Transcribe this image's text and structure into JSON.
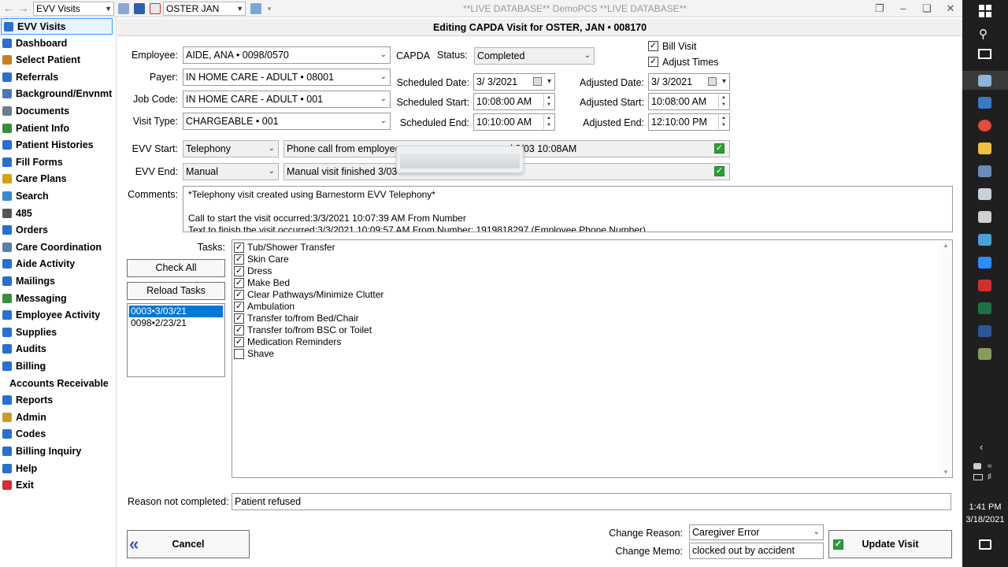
{
  "toolbar": {
    "module_select": "EVV Visits",
    "patient_select": "OSTER JAN",
    "window_title": "**LIVE DATABASE** DemoPCS **LIVE DATABASE**"
  },
  "sidebar": {
    "items": [
      {
        "label": "EVV Visits",
        "icon": "evv-icon",
        "active": true
      },
      {
        "label": "Dashboard",
        "icon": "dashboard-icon"
      },
      {
        "label": "Select Patient",
        "icon": "home-icon"
      },
      {
        "label": "Referrals",
        "icon": "referrals-icon"
      },
      {
        "label": "Background/Envnmt",
        "icon": "background-icon"
      },
      {
        "label": "Documents",
        "icon": "documents-icon"
      },
      {
        "label": "Patient Info",
        "icon": "patient-info-icon"
      },
      {
        "label": "Patient Histories",
        "icon": "histories-icon"
      },
      {
        "label": "Fill Forms",
        "icon": "forms-icon"
      },
      {
        "label": "Care Plans",
        "icon": "care-plans-icon"
      },
      {
        "label": "Search",
        "icon": "search-icon"
      },
      {
        "label": "485",
        "icon": "485-icon"
      },
      {
        "label": "Orders",
        "icon": "orders-icon"
      },
      {
        "label": "Care Coordination",
        "icon": "coordination-icon"
      },
      {
        "label": "Aide Activity",
        "icon": "aide-icon"
      },
      {
        "label": "Mailings",
        "icon": "mailings-icon"
      },
      {
        "label": "Messaging",
        "icon": "messaging-icon"
      },
      {
        "label": "Employee Activity",
        "icon": "employee-icon"
      },
      {
        "label": "Supplies",
        "icon": "supplies-icon"
      },
      {
        "label": "Audits",
        "icon": "audits-icon"
      },
      {
        "label": "Billing",
        "icon": "billing-icon"
      },
      {
        "label": "Accounts Receivable",
        "icon": "ar-icon"
      },
      {
        "label": "Reports",
        "icon": "reports-icon"
      },
      {
        "label": "Admin",
        "icon": "lock-icon"
      },
      {
        "label": "Codes",
        "icon": "codes-icon"
      },
      {
        "label": "Billing Inquiry",
        "icon": "inquiry-icon"
      },
      {
        "label": "Help",
        "icon": "help-icon"
      },
      {
        "label": "Exit",
        "icon": "exit-icon"
      }
    ]
  },
  "heading": "Editing CAPDA Visit for OSTER, JAN • 008170",
  "form": {
    "employee_label": "Employee:",
    "employee_value": "AIDE, ANA • 0098/0570",
    "capda_label": "CAPDA",
    "status_label": "Status:",
    "status_value": "Completed",
    "bill_visit_label": "Bill Visit",
    "adjust_times_label": "Adjust Times",
    "payer_label": "Payer:",
    "payer_value": "IN HOME CARE - ADULT • 08001",
    "job_code_label": "Job Code:",
    "job_code_value": "IN HOME CARE - ADULT • 001",
    "visit_type_label": "Visit Type:",
    "visit_type_value": "CHARGEABLE • 001",
    "scheduled_date_label": "Scheduled Date:",
    "scheduled_date_value": "3/  3/2021",
    "scheduled_start_label": "Scheduled Start:",
    "scheduled_start_value": "10:08:00 AM",
    "scheduled_end_label": "Scheduled End:",
    "scheduled_end_value": "10:10:00 AM",
    "adjusted_date_label": "Adjusted Date:",
    "adjusted_date_value": "3/  3/2021",
    "adjusted_start_label": "Adjusted Start:",
    "adjusted_start_value": "10:08:00 AM",
    "adjusted_end_label": "Adjusted End:",
    "adjusted_end_value": "12:10:00 PM",
    "evv_start_label": "EVV Start:",
    "evv_start_value": "Telephony",
    "evv_start_note_a": "Phone call from employee",
    "evv_start_note_b": "d 3/03 10:08AM",
    "evv_end_label": "EVV End:",
    "evv_end_value": "Manual",
    "evv_end_note": "Manual visit finished 3/03",
    "comments_label": "Comments:",
    "comments_line1": "*Telephony visit created using Barnestorm EVV Telephony*",
    "comments_line2": "Call to start the visit occurred:3/3/2021 10:07:39 AM From Number",
    "comments_line3": "Text to finish the visit occurred:3/3/2021 10:09:57 AM From Number: 1919818297 (Employee Phone Number)",
    "tasks_label": "Tasks:",
    "check_all": "Check All",
    "reload_tasks": "Reload Tasks",
    "visit_list": [
      "0003•3/03/21",
      "0098•2/23/21"
    ],
    "tasks": [
      {
        "label": "Tub/Shower Transfer",
        "checked": true
      },
      {
        "label": "Skin Care",
        "checked": true
      },
      {
        "label": "Dress",
        "checked": true
      },
      {
        "label": "Make Bed",
        "checked": true
      },
      {
        "label": "Clear Pathways/Minimize Clutter",
        "checked": true
      },
      {
        "label": "Ambulation",
        "checked": true
      },
      {
        "label": "Transfer to/from Bed/Chair",
        "checked": true
      },
      {
        "label": "Transfer to/from BSC or Toilet",
        "checked": true
      },
      {
        "label": "Medication Reminders",
        "checked": true
      },
      {
        "label": "Shave",
        "checked": false
      }
    ],
    "reason_label": "Reason not completed:",
    "reason_value": "Patient refused",
    "change_reason_label": "Change Reason:",
    "change_reason_value": "Caregiver Error",
    "change_memo_label": "Change Memo:",
    "change_memo_value": "clocked out by accident",
    "cancel": "Cancel",
    "update": "Update Visit"
  },
  "taskbar": {
    "time": "1:41 PM",
    "date": "3/18/2021"
  },
  "colors": {
    "accent": "#3399ff",
    "selection": "#0078d7",
    "evv_green": "#2e9b3a",
    "taskbar": "#1f1f1f"
  }
}
